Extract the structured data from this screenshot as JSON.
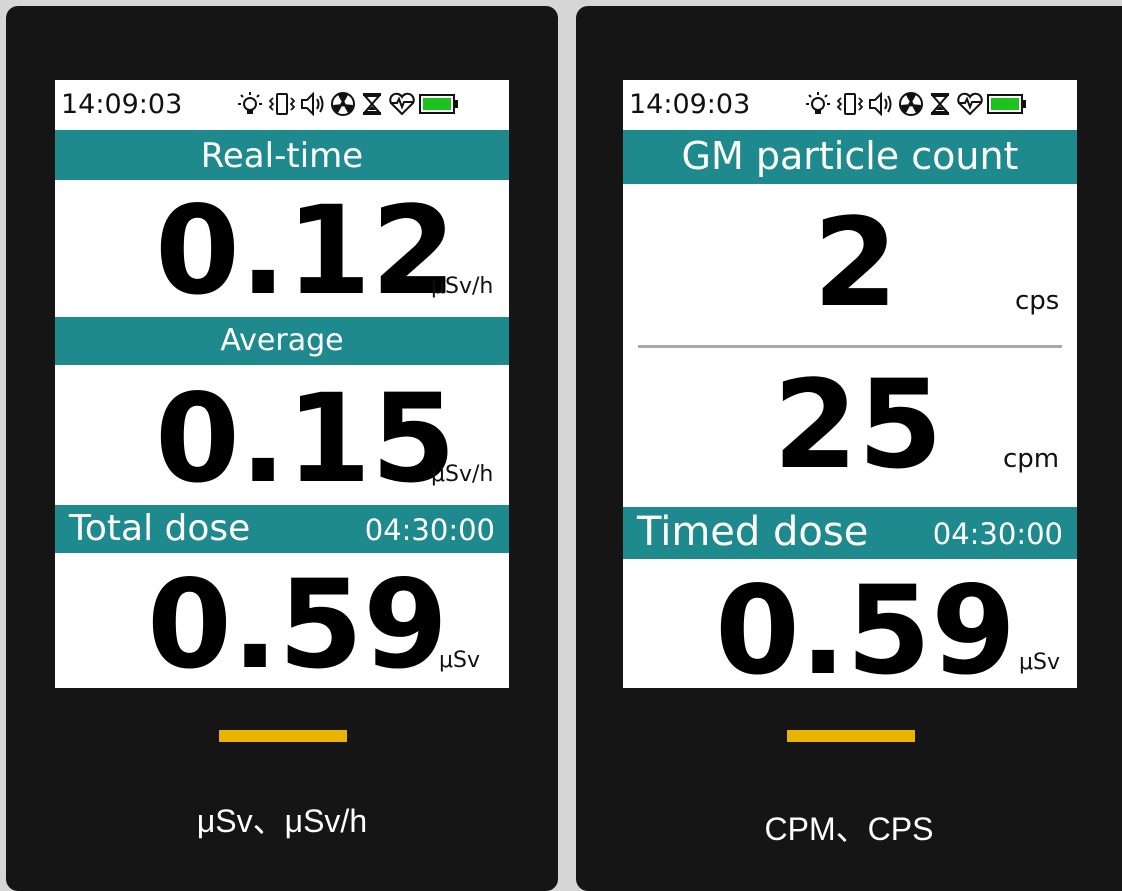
{
  "colors": {
    "band": "#1f8a8e",
    "accent_bar": "#e8b400",
    "panel": "#151515",
    "screen": "#ffffff"
  },
  "status_icons": [
    "light-bulb-icon",
    "vibrate-icon",
    "speaker-icon",
    "radiation-icon",
    "hourglass-icon",
    "heart-pulse-icon",
    "battery-full-icon"
  ],
  "left": {
    "time": "14:09:03",
    "realtime": {
      "label": "Real-time",
      "value": "0.12",
      "unit": "μSv/h"
    },
    "average": {
      "label": "Average",
      "value": "0.15",
      "unit": "μSv/h"
    },
    "total": {
      "label": "Total dose",
      "timer": "04:30:00",
      "value": "0.59",
      "unit": "μSv"
    },
    "caption": "μSv、μSv/h"
  },
  "right": {
    "time": "14:09:03",
    "header": "GM particle count",
    "cps": {
      "value": "2",
      "unit": "cps"
    },
    "cpm": {
      "value": "25",
      "unit": "cpm"
    },
    "timed": {
      "label": "Timed dose",
      "timer": "04:30:00",
      "value": "0.59",
      "unit": "μSv"
    },
    "caption": "CPM、CPS"
  }
}
